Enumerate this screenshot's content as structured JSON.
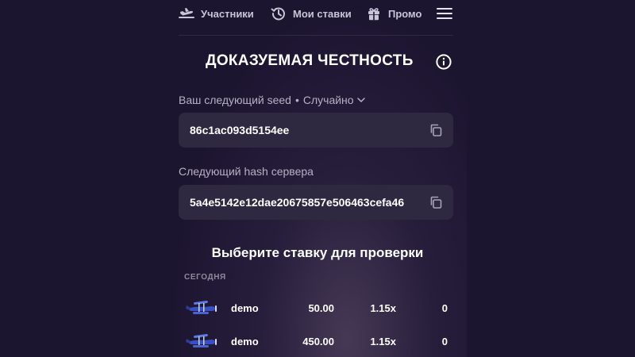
{
  "nav": {
    "participants_label": "Участники",
    "my_bets_label": "Мои ставки",
    "promo_label": "Промо"
  },
  "header": {
    "title": "ДОКАЗУЕМАЯ ЧЕСТНОСТЬ"
  },
  "seed": {
    "label": "Ваш следующий seed",
    "separator": "•",
    "mode": "Случайно",
    "value": "86c1ac093d5154ee"
  },
  "server_hash": {
    "label": "Следующий hash сервера",
    "value": "5a4e5142e12dae20675857e506463cefa46"
  },
  "bets": {
    "title": "Выберите ставку для проверки",
    "group_label": "СЕГОДНЯ",
    "rows": [
      {
        "user": "demo",
        "amount": "50.00",
        "multiplier": "1.15x",
        "win": "0"
      },
      {
        "user": "demo",
        "amount": "450.00",
        "multiplier": "1.15x",
        "win": "0"
      }
    ]
  },
  "colors": {
    "background": "#1b1530",
    "field_bg": "#2e2840",
    "muted_text": "#b7b1c5"
  },
  "icons": [
    "plane-icon",
    "history-icon",
    "gift-icon",
    "menu-icon",
    "info-icon",
    "copy-icon",
    "chevron-down-icon",
    "biplane-icon"
  ]
}
